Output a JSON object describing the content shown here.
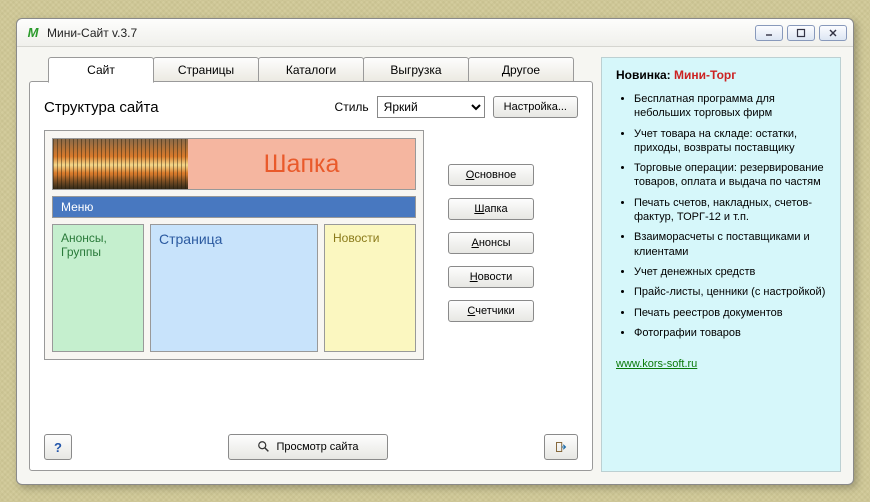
{
  "window": {
    "title": "Мини-Сайт v.3.7"
  },
  "tabs": [
    "Сайт",
    "Страницы",
    "Каталоги",
    "Выгрузка",
    "Другое"
  ],
  "panel": {
    "heading": "Структура сайта",
    "style_label": "Стиль",
    "style_value": "Яркий",
    "settings_button": "Настройка..."
  },
  "preview": {
    "header_title": "Шапка",
    "menu_label": "Меню",
    "columns": {
      "announcements": "Анонсы,\nГруппы",
      "page": "Страница",
      "news": "Новости"
    }
  },
  "side_buttons": [
    {
      "label": "Основное",
      "u": "О"
    },
    {
      "label": "Шапка",
      "u": "Ш"
    },
    {
      "label": "Анонсы",
      "u": "А"
    },
    {
      "label": "Новости",
      "u": "Н"
    },
    {
      "label": "Счетчики",
      "u": "С"
    }
  ],
  "bottom": {
    "help": "?",
    "preview": "Просмотр сайта"
  },
  "info": {
    "novelty_label": "Новинка: ",
    "novelty_product": "Мини-Торг",
    "bullets": [
      "Бесплатная программа для небольших торговых фирм",
      "Учет товара на складе: остатки, приходы, возвраты поставщику",
      "Торговые операции: резервирование товаров, оплата и выдача по частям",
      "Печать счетов, накладных, счетов-фактур, ТОРГ-12 и т.п.",
      "Взаиморасчеты с поставщиками и клиентами",
      "Учет денежных средств",
      "Прайс-листы, ценники (с настройкой)",
      "Печать реестров документов",
      "Фотографии товаров"
    ],
    "link": "www.kors-soft.ru"
  }
}
